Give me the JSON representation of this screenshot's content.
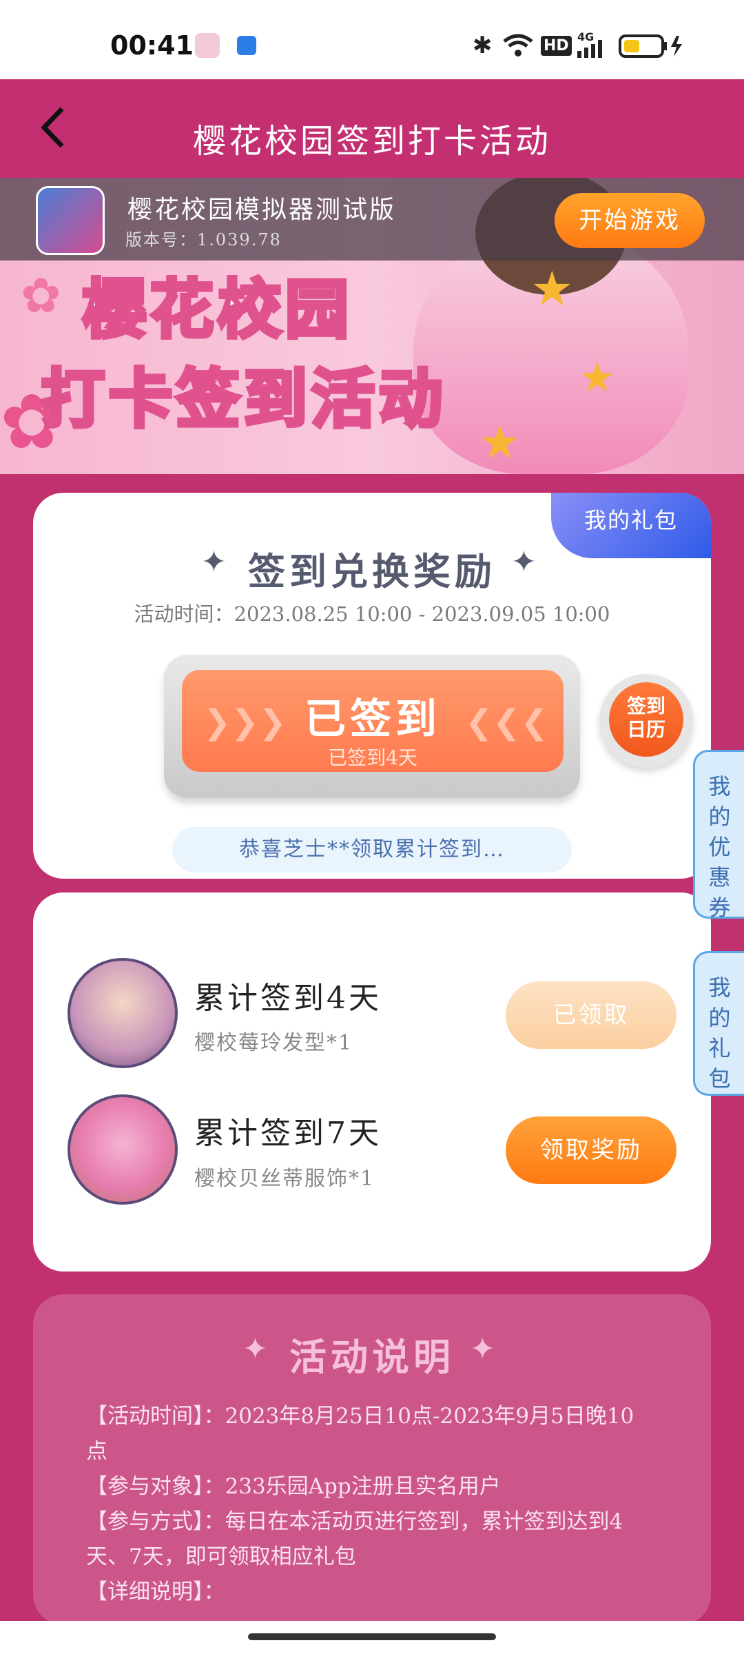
{
  "status_bar": {
    "time": "00:41",
    "network": "4G",
    "hd": "HD",
    "battery_level": 0.35
  },
  "header": {
    "title": "樱花校园签到打卡活动"
  },
  "game_bar": {
    "name": "樱花校园模拟器测试版",
    "version": "版本号：1.039.78",
    "start_button": "开始游戏"
  },
  "banner": {
    "line1": "樱花校园",
    "line2": "打卡签到活动"
  },
  "signin_card": {
    "my_gift_tag": "我的礼包",
    "title": "签到兑换奖励",
    "activity_time": "活动时间：2023.08.25 10:00 - 2023.09.05 10:00",
    "checkin_label": "已签到",
    "checkin_sub": "已签到4天",
    "calendar_button": "签到日历",
    "marquee": "恭喜芝士**领取累计签到…"
  },
  "rewards": [
    {
      "title": "累计签到4天",
      "item": "樱校莓玲发型*1",
      "button": "已领取",
      "claimed": true
    },
    {
      "title": "累计签到7天",
      "item": "樱校贝丝蒂服饰*1",
      "button": "领取奖励",
      "claimed": false
    }
  ],
  "side_tabs": {
    "coupons": "我的优惠券",
    "gifts": "我的礼包"
  },
  "description": {
    "title": "活动说明",
    "lines": [
      "【活动时间】：2023年8月25日10点-2023年9月5日晚10点",
      "【参与对象】：233乐园App注册且实名用户",
      "【参与方式】：每日在本活动页进行签到，累计签到达到4天、7天，即可领取相应礼包",
      "【详细说明】："
    ]
  },
  "colors": {
    "page_bg": "#c1306f",
    "accent_orange": "#ff7a12",
    "claimed_btn": "#fdd9b0",
    "side_tab_bg": "#d8ecfb"
  }
}
